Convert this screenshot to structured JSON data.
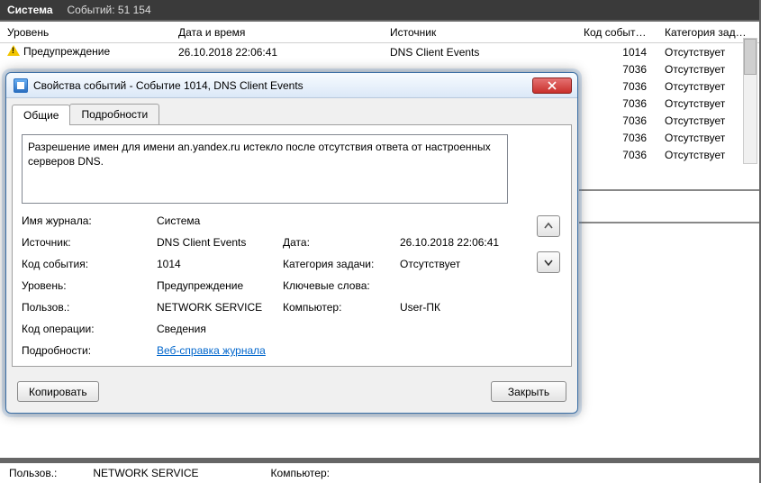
{
  "header": {
    "log_name": "Система",
    "event_count_text": "Событий: 51 154"
  },
  "list": {
    "columns": {
      "level": "Уровень",
      "date": "Дата и время",
      "source": "Источник",
      "code": "Код события",
      "category": "Категория задачи"
    },
    "rows": [
      {
        "icon": "warning",
        "level": "Предупреждение",
        "date": "26.10.2018 22:06:41",
        "source": "DNS Client Events",
        "code": "1014",
        "category": "Отсутствует"
      },
      {
        "icon": "",
        "level": "",
        "date": "",
        "source": "",
        "code": "7036",
        "category": "Отсутствует"
      },
      {
        "icon": "",
        "level": "",
        "date": "",
        "source": "",
        "code": "7036",
        "category": "Отсутствует"
      },
      {
        "icon": "",
        "level": "",
        "date": "",
        "source": "",
        "code": "7036",
        "category": "Отсутствует"
      },
      {
        "icon": "",
        "level": "",
        "date": "",
        "source": "",
        "code": "7036",
        "category": "Отсутствует"
      },
      {
        "icon": "",
        "level": "",
        "date": "",
        "source": "",
        "code": "7036",
        "category": "Отсутствует"
      },
      {
        "icon": "",
        "level": "",
        "date": "",
        "source": "",
        "code": "7036",
        "category": "Отсутствует"
      }
    ]
  },
  "preview": {
    "user_label": "Пользов.:",
    "user_value": "NETWORK SERVICE",
    "computer_label": "Компьютер:"
  },
  "dialog": {
    "title": "Свойства событий - Событие 1014, DNS Client Events",
    "tabs": {
      "general": "Общие",
      "details": "Подробности"
    },
    "description": "Разрешение имен для имени an.yandex.ru истекло после отсутствия ответа от настроенных серверов DNS.",
    "fields": {
      "log_name": {
        "label": "Имя журнала:",
        "value": "Система"
      },
      "source": {
        "label": "Источник:",
        "value": "DNS Client Events"
      },
      "date": {
        "label": "Дата:",
        "value": "26.10.2018 22:06:41"
      },
      "event_id": {
        "label": "Код события:",
        "value": "1014"
      },
      "task_category": {
        "label": "Категория задачи:",
        "value": "Отсутствует"
      },
      "level": {
        "label": "Уровень:",
        "value": "Предупреждение"
      },
      "keywords": {
        "label": "Ключевые слова:",
        "value": ""
      },
      "user": {
        "label": "Пользов.:",
        "value": "NETWORK SERVICE"
      },
      "computer": {
        "label": "Компьютер:",
        "value": "User-ПК"
      },
      "opcode": {
        "label": "Код операции:",
        "value": "Сведения"
      },
      "more_info": {
        "label": "Подробности:",
        "link": "Веб-справка журнала"
      }
    },
    "buttons": {
      "copy": "Копировать",
      "close": "Закрыть"
    }
  }
}
